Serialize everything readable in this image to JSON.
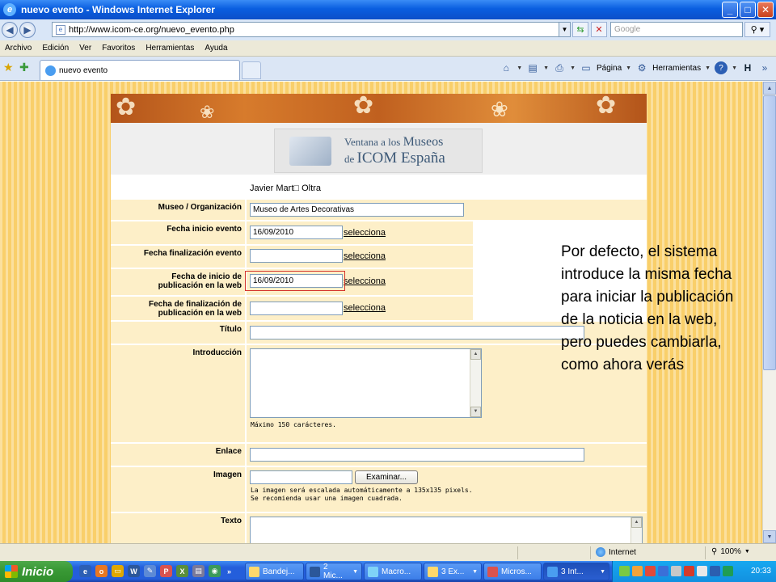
{
  "window": {
    "title": "nuevo evento - Windows Internet Explorer",
    "min": "_",
    "max": "□",
    "close": "✕"
  },
  "address": {
    "url": "http://www.icom-ce.org/nuevo_evento.php",
    "search_placeholder": "Google"
  },
  "menu": [
    "Archivo",
    "Edición",
    "Ver",
    "Favoritos",
    "Herramientas",
    "Ayuda"
  ],
  "tab": {
    "label": "nuevo evento"
  },
  "commands": {
    "page": "Página",
    "tools": "Herramientas"
  },
  "page": {
    "logo_line1a": "Ventana a los ",
    "logo_line1b": "Museos",
    "logo_line2a": "de ",
    "logo_line2b": "ICOM España",
    "user": "Javier Mart□ Oltra",
    "fields": {
      "museo_label": "Museo / Organización",
      "museo_value": "Museo de Artes Decorativas",
      "fecha_inicio_label": "Fecha inicio evento",
      "fecha_inicio_value": "16/09/2010",
      "fecha_fin_label": "Fecha finalización evento",
      "fecha_fin_value": "",
      "pub_inicio_label_1": "Fecha de inicio de",
      "pub_inicio_label_2": "publicación en la web",
      "pub_inicio_value": "16/09/2010",
      "pub_fin_label_1": "Fecha de finalización de",
      "pub_fin_label_2": "publicación en la web",
      "pub_fin_value": "",
      "titulo_label": "Título",
      "intro_label": "Introducción",
      "intro_hint": "Máximo 150 carácteres.",
      "enlace_label": "Enlace",
      "imagen_label": "Imagen",
      "examinar": "Examinar...",
      "imagen_hint_1": "La imagen será escalada automáticamente a 135x135 pixels.",
      "imagen_hint_2": "Se recomienda usar una imagen cuadrada.",
      "texto_label": "Texto",
      "select_link": "selecciona"
    }
  },
  "callout": "Por defecto, el sistema introduce la misma fecha para iniciar la publicación de la noticia en la web, pero puedes cambiarla, como ahora verás",
  "status": {
    "zone": "Internet",
    "zoom": "100%"
  },
  "taskbar": {
    "start": "Inicio",
    "tasks": [
      "Bandej...",
      "2 Mic...",
      "Macro...",
      "3 Ex...",
      "Micros...",
      "3 Int..."
    ],
    "time": "20:33"
  },
  "colors": {
    "accent": "#245edb",
    "page_bg": "#f9cf6a",
    "row_bg": "#fdefc8",
    "highlight": "#d4332b"
  }
}
